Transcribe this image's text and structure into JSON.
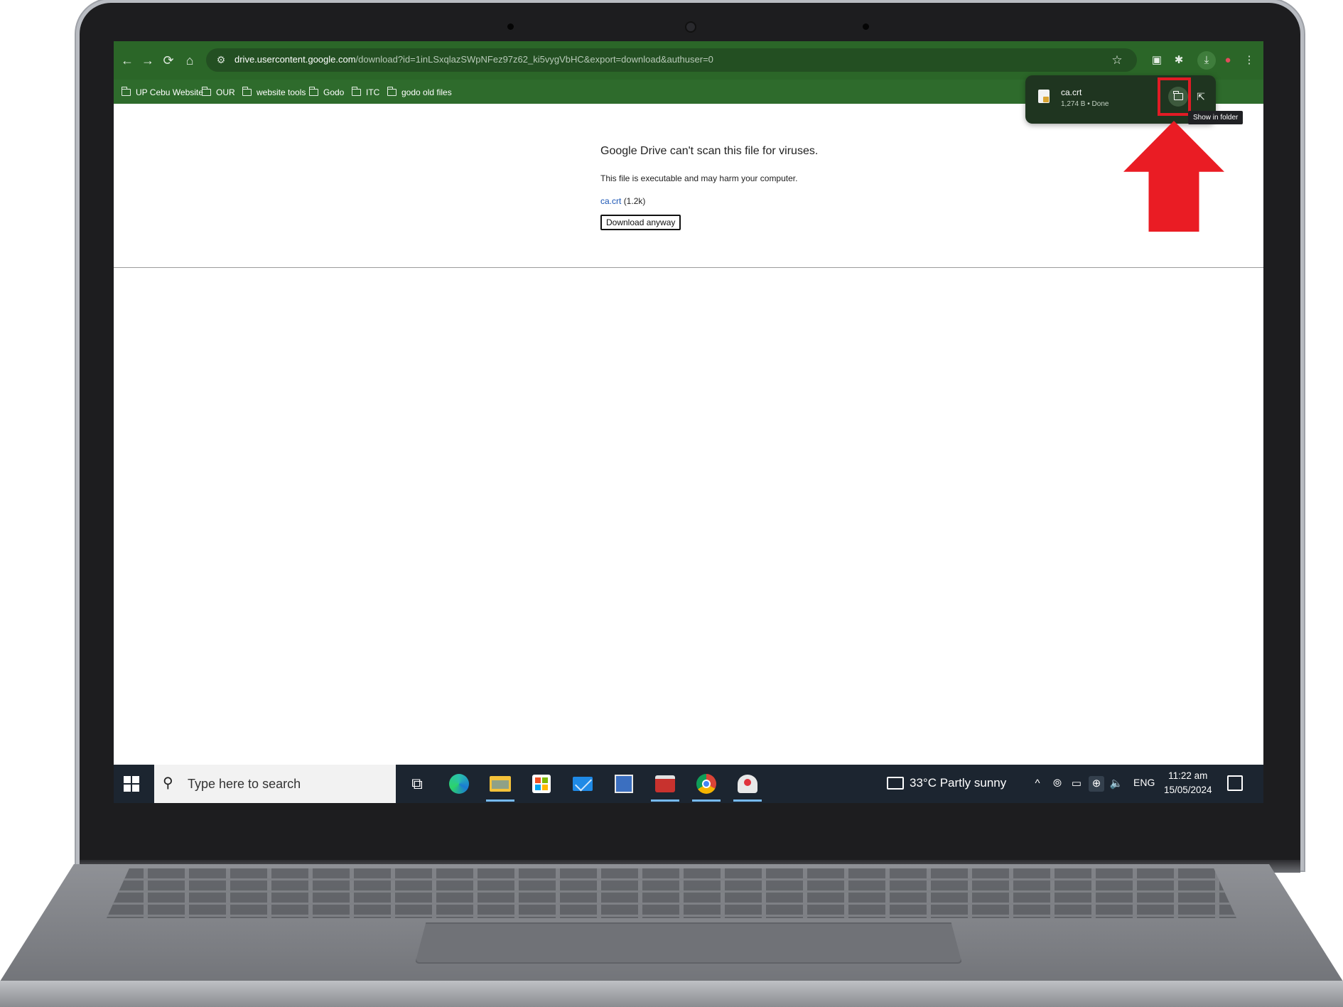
{
  "browser": {
    "url_host": "drive.usercontent.google.com",
    "url_path": "/download?id=1inLSxqlazSWpNFez97z62_ki5vygVbHC&export=download&authuser=0",
    "bookmarks": [
      {
        "label": "UP Cebu Website"
      },
      {
        "label": "OUR"
      },
      {
        "label": "website tools"
      },
      {
        "label": "Godo"
      },
      {
        "label": "ITC"
      },
      {
        "label": "godo old files"
      }
    ],
    "icons": {
      "back": "←",
      "forward": "→",
      "reload": "⟳",
      "home": "⌂",
      "tune": "⚙",
      "star": "☆",
      "screenshot": "▣",
      "extensions": "✱",
      "download": "⤓",
      "menu": "⋮",
      "open_external": "⇱"
    }
  },
  "download_bubble": {
    "file_name": "ca.crt",
    "status": "1,274 B • Done",
    "tooltip": "Show in folder"
  },
  "page": {
    "title": "Google Drive can't scan this file for viruses.",
    "subtitle": "This file is executable and may harm your computer.",
    "file_link": "ca.crt",
    "file_size": "(1.2k)",
    "download_button": "Download anyway"
  },
  "taskbar": {
    "search_placeholder": "Type here to search",
    "search_glyph": "⚲",
    "task_view_glyph": "⧉",
    "weather": "33°C  Partly sunny",
    "tray": {
      "chevron": "^",
      "meet": "⦾",
      "battery": "▭",
      "network": "⊕",
      "volume": "🔈"
    },
    "language": "ENG",
    "time": "11:22 am",
    "date": "15/05/2024"
  },
  "colors": {
    "chrome_green": "#2e6b2c",
    "accent_red": "#ea1c24",
    "link_blue": "#1a55b5",
    "taskbar": "#1c2530"
  }
}
